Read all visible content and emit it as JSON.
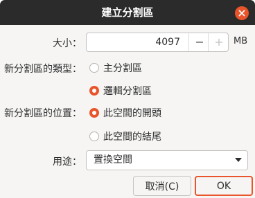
{
  "window": {
    "title": "建立分割區"
  },
  "size": {
    "label": "大小：",
    "value": "4097",
    "unit": "MB"
  },
  "partition_type": {
    "label": "新分割區的類型：",
    "options": [
      {
        "label": "主分割區",
        "selected": false
      },
      {
        "label": "邏輯分割區",
        "selected": true
      }
    ]
  },
  "location": {
    "label": "新分割區的位置：",
    "options": [
      {
        "label": "此空間的開頭",
        "selected": true
      },
      {
        "label": "此空間的結尾",
        "selected": false
      }
    ]
  },
  "use_as": {
    "label": "用途：",
    "selected": "置換空間"
  },
  "buttons": {
    "cancel": "取消(C)",
    "ok": "OK"
  },
  "colors": {
    "accent": "#e9542a",
    "titlebar": "#2b2b2b",
    "background": "#f6f5f4"
  }
}
